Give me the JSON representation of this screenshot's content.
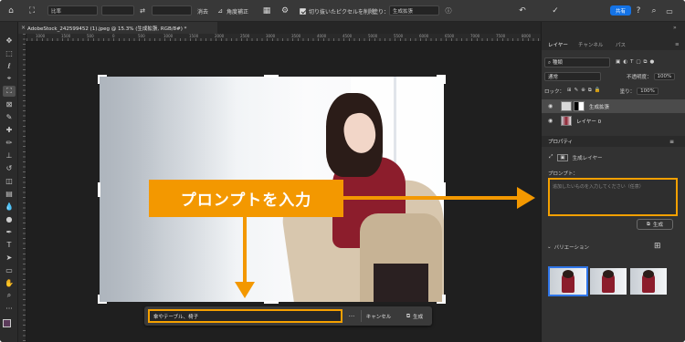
{
  "options_bar": {
    "ratio_label": "比率",
    "clear_label": "消去",
    "straighten_label": "角度補正",
    "delete_cropped_label": "切り抜いたピクセルを削除",
    "fill_label": "塗り：",
    "fill_value": "生成拡張",
    "share_label": "共有"
  },
  "document": {
    "tab_title": "AdobeStock_242599452 (1).jpeg @ 15.3% (生成拡張, RGB/8#) *"
  },
  "ruler": {
    "ticks": [
      "1000",
      "1500",
      "500",
      "0",
      "500",
      "1000",
      "1500",
      "2000",
      "2500",
      "3000",
      "3500",
      "4000",
      "4500",
      "5000",
      "5500",
      "6000",
      "6500",
      "7000",
      "7500",
      "8000"
    ]
  },
  "contextual_bar": {
    "prompt_value": "傘やテーブル、椅子",
    "more": "···",
    "cancel_label": "キャンセル",
    "generate_label": "生成"
  },
  "callout": {
    "text": "プロンプトを入力"
  },
  "panel": {
    "tabs": [
      "レイヤー",
      "チャンネル",
      "パス"
    ],
    "search_kind": "種類",
    "blend_mode": "通常",
    "opacity_label": "不透明度：",
    "opacity_value": "100%",
    "lock_label": "ロック：",
    "fill_label": "塗り：",
    "fill_value": "100%",
    "layers": [
      {
        "name": "生成拡張"
      },
      {
        "name": "レイヤー 0"
      }
    ],
    "properties_title": "プロパティ",
    "generative_layer_label": "生成レイヤー",
    "prompt_label": "プロンプト：",
    "prompt_placeholder": "追加したいものを入力してください（任意）",
    "generate_label": "生成",
    "variations_label": "バリエーション"
  }
}
